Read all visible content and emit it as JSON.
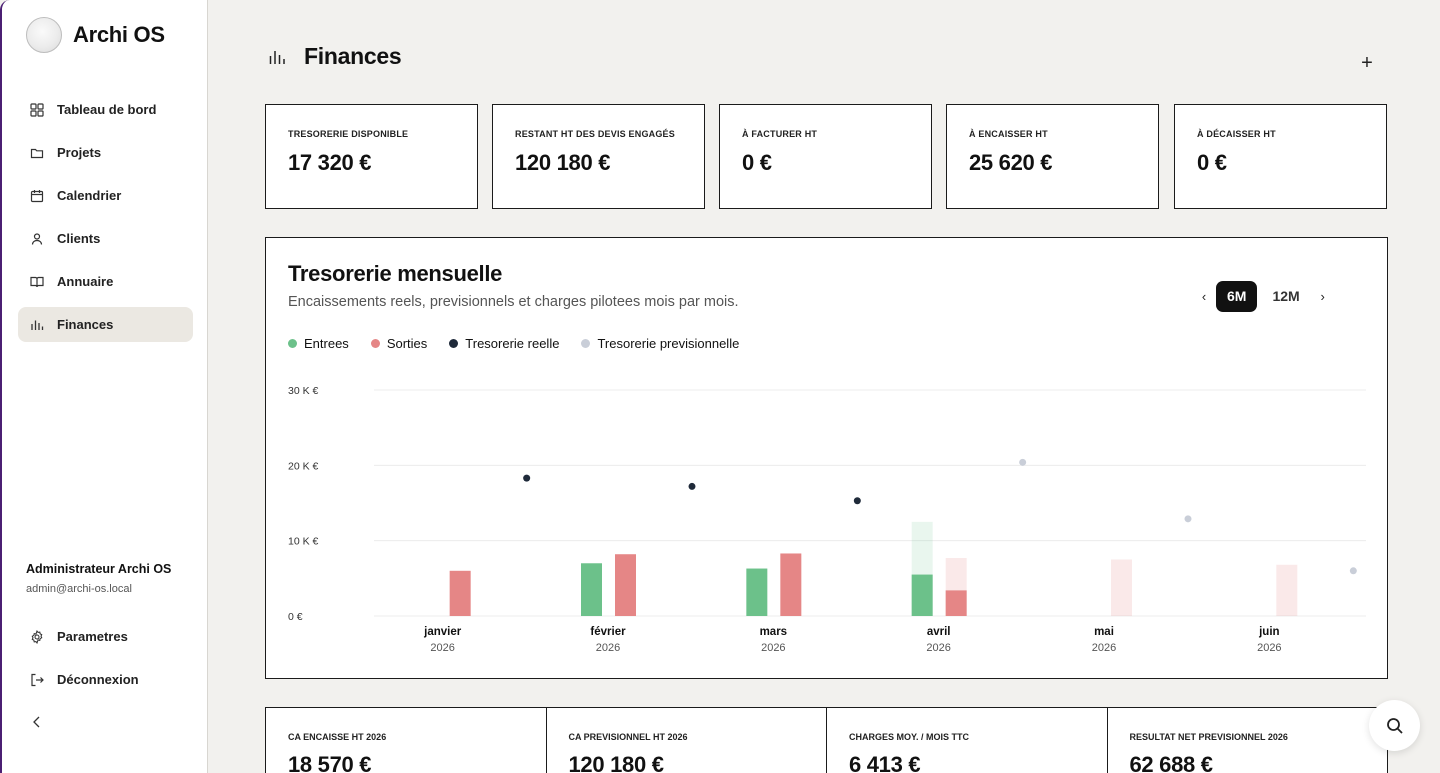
{
  "app": {
    "name": "Archi OS"
  },
  "sidebar": {
    "items": [
      {
        "label": "Tableau de bord",
        "icon": "grid-icon"
      },
      {
        "label": "Projets",
        "icon": "folder-icon"
      },
      {
        "label": "Calendrier",
        "icon": "calendar-icon"
      },
      {
        "label": "Clients",
        "icon": "user-icon"
      },
      {
        "label": "Annuaire",
        "icon": "book-icon"
      },
      {
        "label": "Finances",
        "icon": "bar-chart-icon",
        "active": true
      }
    ],
    "user": {
      "name": "Administrateur Archi OS",
      "email": "admin@archi-os.local"
    },
    "bottom": [
      {
        "label": "Parametres",
        "icon": "gear-icon"
      },
      {
        "label": "Déconnexion",
        "icon": "logout-icon"
      }
    ]
  },
  "page": {
    "title": "Finances",
    "add_label": "+"
  },
  "kpis": [
    {
      "label": "TRESORERIE DISPONIBLE",
      "value": "17 320 €"
    },
    {
      "label": "RESTANT HT DES DEVIS ENGAGÉS",
      "value": "120 180 €"
    },
    {
      "label": "À FACTURER HT",
      "value": "0 €"
    },
    {
      "label": "À ENCAISSER HT",
      "value": "25 620 €"
    },
    {
      "label": "À DÉCAISSER HT",
      "value": "0 €"
    }
  ],
  "chart_card": {
    "title": "Tresorerie mensuelle",
    "subtitle": "Encaissements reels, previsionnels et charges pilotees mois par mois.",
    "period": {
      "prev": "‹",
      "next": "›",
      "options": [
        "6M",
        "12M"
      ],
      "selected": "6M"
    }
  },
  "colors": {
    "entrees": "#6cc18a",
    "sorties": "#e58686",
    "reelle": "#1f2a3a",
    "previsionnelle": "#c9ced8"
  },
  "chart_data": {
    "type": "bar",
    "legend": [
      "Entrees",
      "Sorties",
      "Tresorerie reelle",
      "Tresorerie previsionnelle"
    ],
    "ytick_labels": [
      "0 €",
      "10 K €",
      "20 K €",
      "30 K €"
    ],
    "ylim": [
      0,
      30000
    ],
    "categories": [
      "janvier",
      "février",
      "mars",
      "avril",
      "mai",
      "juin"
    ],
    "years": [
      "2026",
      "2026",
      "2026",
      "2026",
      "2026",
      "2026"
    ],
    "series": [
      {
        "name": "Entrees",
        "values": [
          0,
          7000,
          6300,
          5500
        ]
      },
      {
        "name": "Entrees",
        "values": [
          null,
          null,
          null,
          12500,
          null,
          null
        ]
      },
      {
        "name": "Sorties",
        "values": [
          6000,
          8200,
          8300,
          3400
        ]
      },
      {
        "name": "Sorties",
        "values": [
          null,
          null,
          null,
          7700,
          7500,
          6800
        ]
      },
      {
        "name": "Tresorerie reelle",
        "values": [
          18300,
          17200,
          15300
        ]
      },
      {
        "name": "Tresorerie previsionnelle",
        "values": [
          null,
          null,
          null,
          20400,
          12900,
          6000
        ]
      }
    ]
  },
  "stats": [
    {
      "label": "CA ENCAISSE HT 2026",
      "value": "18 570 €"
    },
    {
      "label": "CA PREVISIONNEL HT 2026",
      "value": "120 180 €"
    },
    {
      "label": "CHARGES MOY. / MOIS TTC",
      "value": "6 413 €"
    },
    {
      "label": "RESULTAT NET PREVISIONNEL 2026",
      "value": "62 688 €"
    }
  ]
}
